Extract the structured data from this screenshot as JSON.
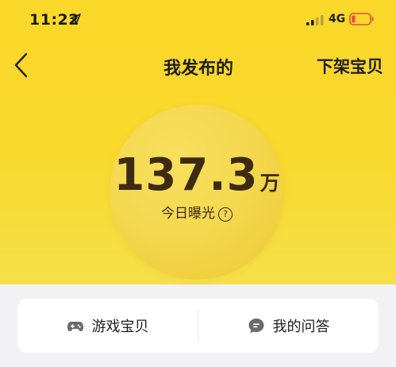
{
  "status_bar": {
    "time": "11:22",
    "network": "4G",
    "icons": [
      "location-arrow-icon",
      "cellular-signal-icon",
      "battery-icon"
    ],
    "battery_color": "#e24a3a"
  },
  "nav": {
    "back_icon": "chevron-left-icon",
    "title": "我发布的",
    "action_label": "下架宝贝"
  },
  "exposure": {
    "value": "137.3",
    "unit": "万",
    "label": "今日曝光",
    "help_icon": "question-circle-icon",
    "help_glyph": "?"
  },
  "card": {
    "items": [
      {
        "icon": "gamepad-icon",
        "label": "游戏宝贝"
      },
      {
        "icon": "chat-bubble-icon",
        "label": "我的问答"
      }
    ]
  },
  "colors": {
    "hero_yellow": "#fad82a",
    "circle_yellow": "#f4d84f",
    "value_brown": "#3d2a13",
    "background": "#f2f2f4",
    "card": "#ffffff"
  }
}
